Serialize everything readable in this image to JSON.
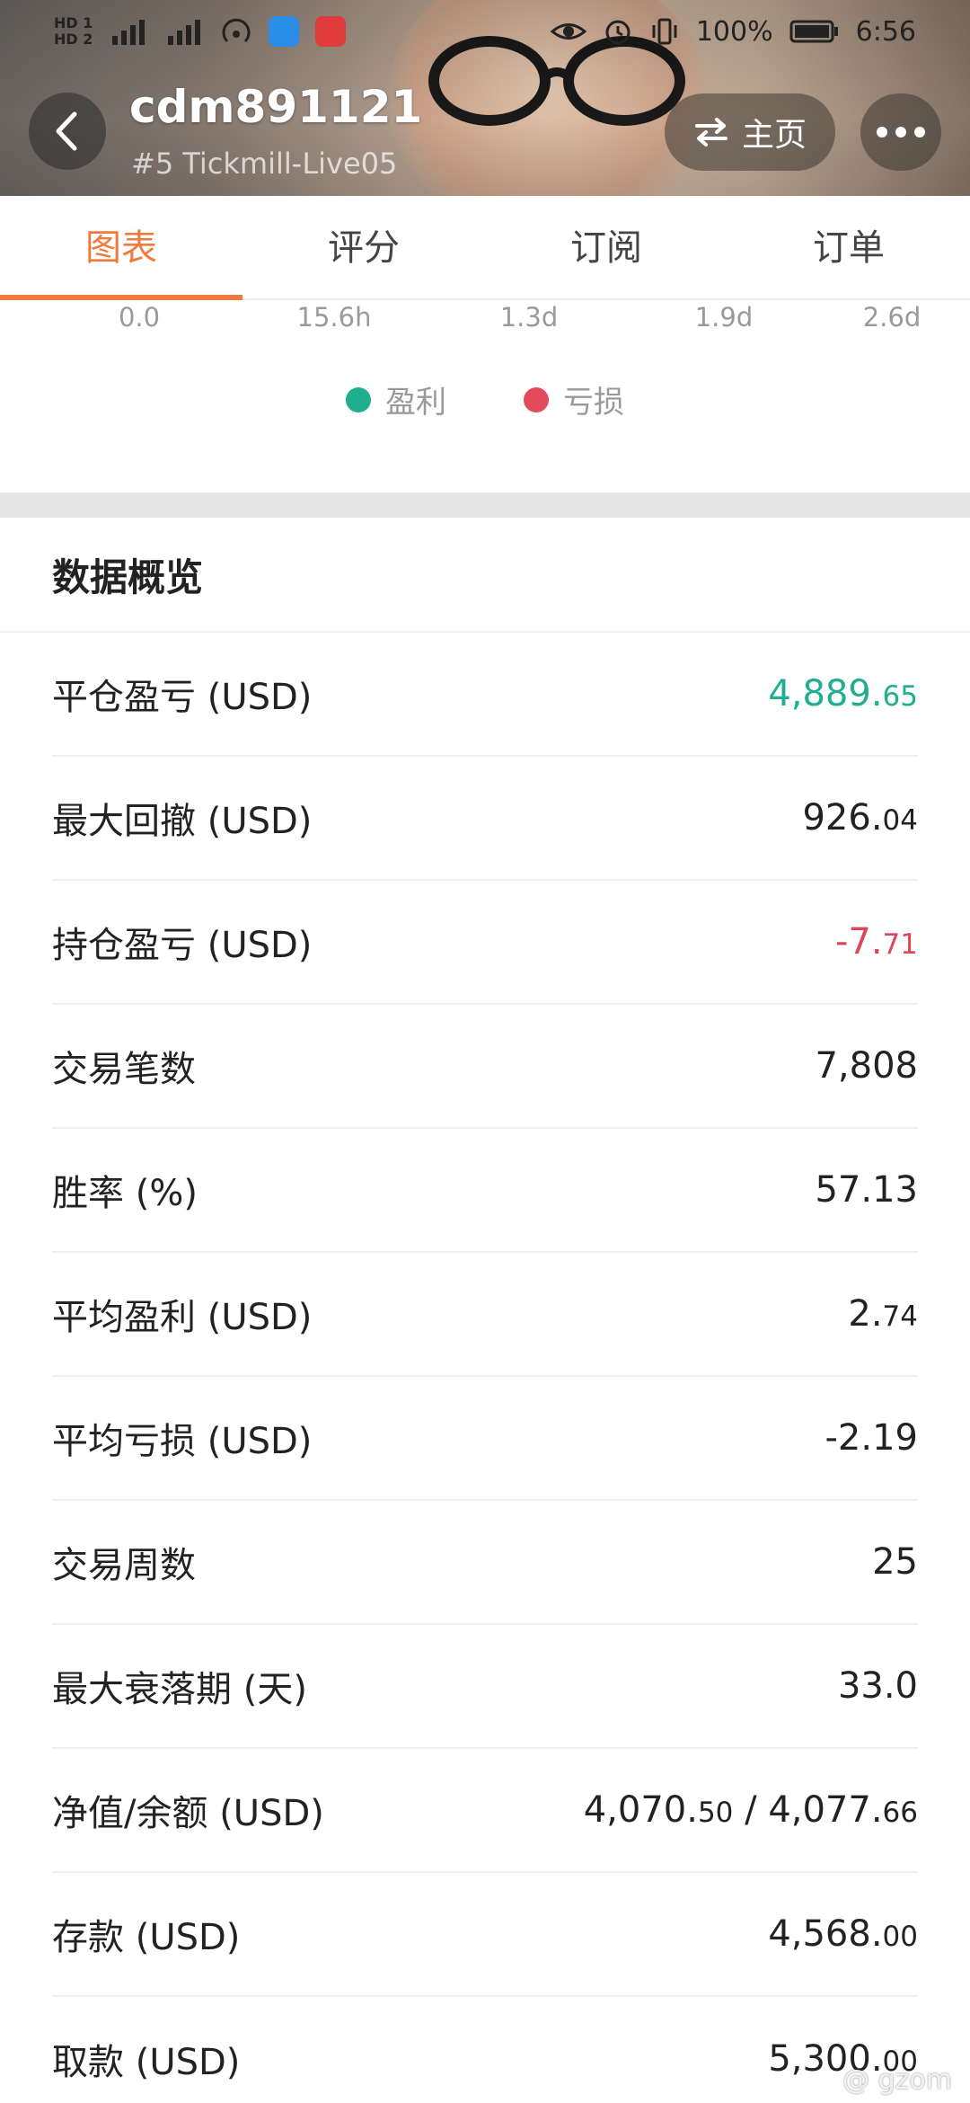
{
  "status_bar": {
    "sim1": "HD 1",
    "sim2": "HD 2",
    "battery": "100%",
    "time": "6:56"
  },
  "header": {
    "username": "cdm891121",
    "subtitle": "#5 Tickmill-Live05",
    "home_label": "主页"
  },
  "tabs": [
    {
      "label": "图表",
      "active": true
    },
    {
      "label": "评分",
      "active": false
    },
    {
      "label": "订阅",
      "active": false
    },
    {
      "label": "订单",
      "active": false
    }
  ],
  "chart": {
    "x_ticks": [
      "0.0",
      "15.6h",
      "1.3d",
      "1.9d",
      "2.6d"
    ],
    "legend": [
      {
        "label": "盈利",
        "color": "#1fae8e"
      },
      {
        "label": "亏损",
        "color": "#e44b5a"
      }
    ]
  },
  "overview": {
    "title": "数据概览",
    "rows": [
      {
        "label": "平仓盈亏 (USD)",
        "int": "4,889.",
        "dec": "65",
        "tone": "pos"
      },
      {
        "label": "最大回撤 (USD)",
        "int": "926.",
        "dec": "04",
        "tone": ""
      },
      {
        "label": "持仓盈亏 (USD)",
        "int": "-7.",
        "dec": "71",
        "tone": "neg"
      },
      {
        "label": "交易笔数",
        "int": "7,808",
        "dec": "",
        "tone": ""
      },
      {
        "label": "胜率 (%)",
        "int": "57.13",
        "dec": "",
        "tone": ""
      },
      {
        "label": "平均盈利 (USD)",
        "int": "2.",
        "dec": "74",
        "tone": ""
      },
      {
        "label": "平均亏损 (USD)",
        "int": "-2.19",
        "dec": "",
        "tone": ""
      },
      {
        "label": "交易周数",
        "int": "25",
        "dec": "",
        "tone": ""
      },
      {
        "label": "最大衰落期 (天)",
        "int": "33.0",
        "dec": "",
        "tone": ""
      },
      {
        "label": "净值/余额 (USD)",
        "int": "4,070.",
        "dec": "50",
        "int2": " / 4,077.",
        "dec2": "66",
        "tone": ""
      },
      {
        "label": "存款 (USD)",
        "int": "4,568.",
        "dec": "00",
        "tone": ""
      },
      {
        "label": "取款 (USD)",
        "int": "5,300.",
        "dec": "00",
        "tone": ""
      }
    ]
  },
  "watermark": "@ gzom"
}
